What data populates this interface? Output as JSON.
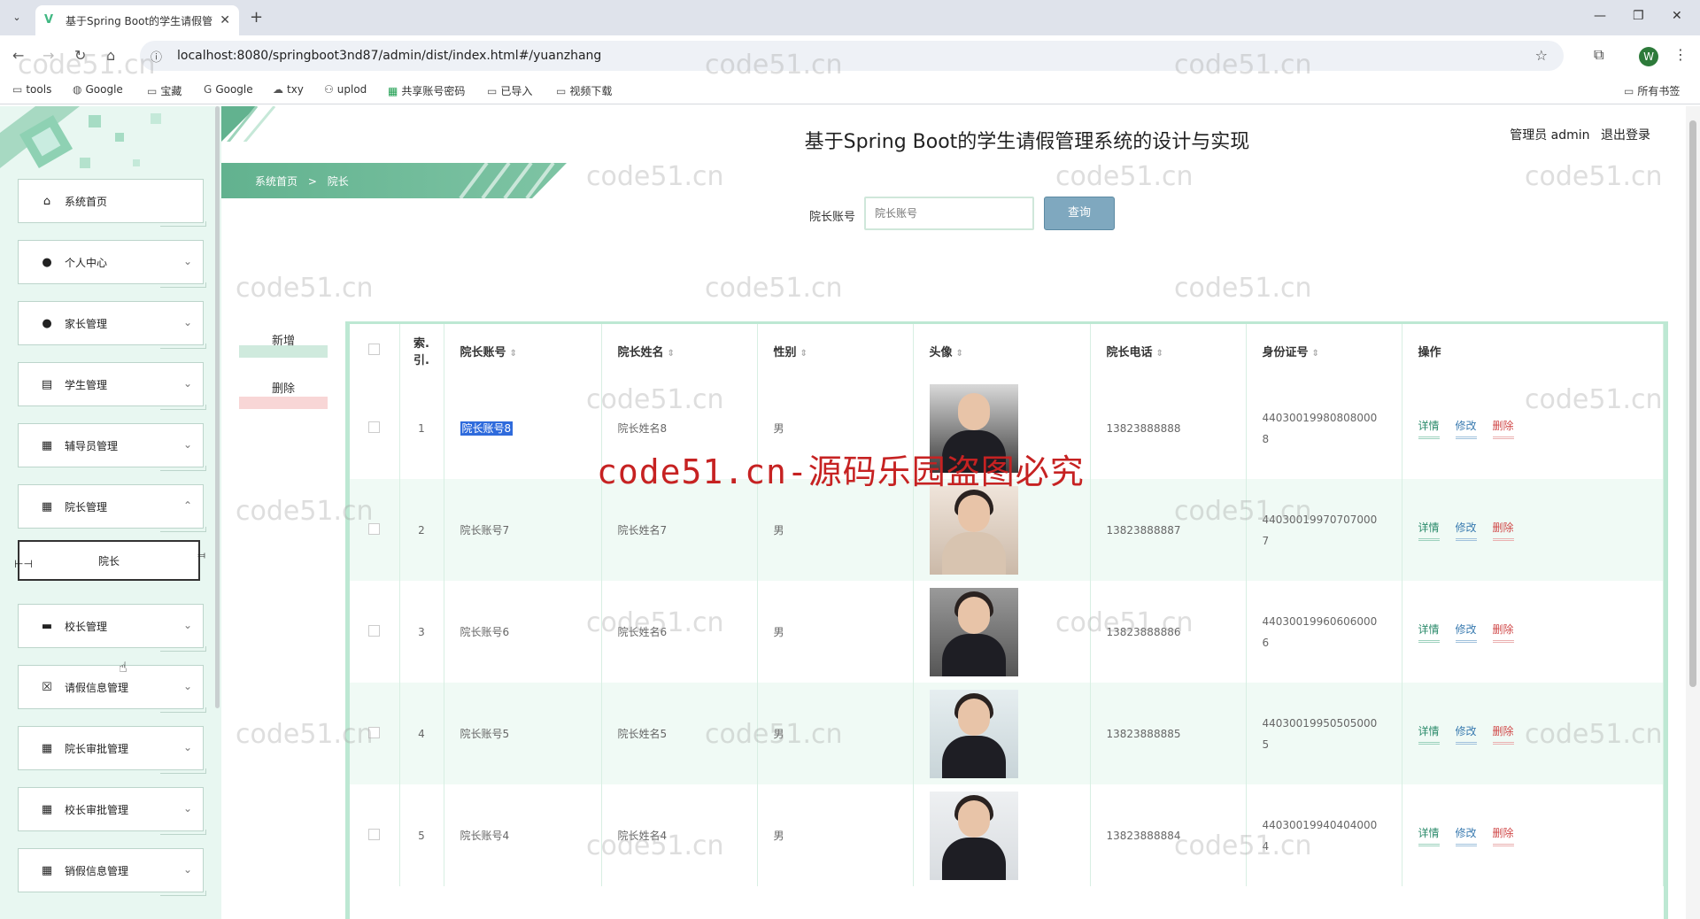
{
  "browser": {
    "tab_title": "基于Spring Boot的学生请假管",
    "url": "localhost:8080/springboot3nd87/admin/dist/index.html#/yuanzhang",
    "profile_initial": "W",
    "bookmarks": [
      {
        "label": "tools",
        "icon": "folder-icon"
      },
      {
        "label": "Google",
        "icon": "globe-icon"
      },
      {
        "label": "宝藏",
        "icon": "folder-icon"
      },
      {
        "label": "Google",
        "icon": "google-icon"
      },
      {
        "label": "txy",
        "icon": "cloud-icon"
      },
      {
        "label": "uplod",
        "icon": "people-icon"
      },
      {
        "label": "共享账号密码",
        "icon": "sheet-icon"
      },
      {
        "label": "已导入",
        "icon": "folder-icon"
      },
      {
        "label": "视频下载",
        "icon": "folder-icon"
      }
    ],
    "all_bookmarks": "所有书签"
  },
  "header": {
    "title": "基于Spring Boot的学生请假管理系统的设计与实现",
    "user_label": "管理员 admin",
    "logout": "退出登录"
  },
  "breadcrumb": {
    "home": "系统首页",
    "separator": ">",
    "current": "院长"
  },
  "sidebar": {
    "items": [
      {
        "label": "系统首页",
        "icon": "home-icon",
        "chevron": ""
      },
      {
        "label": "个人中心",
        "icon": "user-icon",
        "chevron": "⌄"
      },
      {
        "label": "家长管理",
        "icon": "user-icon",
        "chevron": "⌄"
      },
      {
        "label": "学生管理",
        "icon": "clipboard-icon",
        "chevron": "⌄"
      },
      {
        "label": "辅导员管理",
        "icon": "grid-icon",
        "chevron": "⌄"
      },
      {
        "label": "院长管理",
        "icon": "grid-icon",
        "chevron": "⌃"
      },
      {
        "label": "校长管理",
        "icon": "monitor-icon",
        "chevron": "⌄"
      },
      {
        "label": "请假信息管理",
        "icon": "calendar-x-icon",
        "chevron": "⌄"
      },
      {
        "label": "院长审批管理",
        "icon": "grid-icon",
        "chevron": "⌄"
      },
      {
        "label": "校长审批管理",
        "icon": "grid-icon",
        "chevron": "⌄"
      },
      {
        "label": "销假信息管理",
        "icon": "grid-icon",
        "chevron": "⌄"
      }
    ],
    "submenu_label": "院长"
  },
  "search": {
    "label": "院长账号",
    "placeholder": "院长账号",
    "button": "查询"
  },
  "actions": {
    "add": "新增",
    "delete": "删除"
  },
  "table": {
    "columns": [
      "索引",
      "院长账号",
      "院长姓名",
      "性别",
      "头像",
      "院长电话",
      "身份证号",
      "操作"
    ],
    "index_header": "索.\n引.",
    "ops": {
      "detail": "详情",
      "edit": "修改",
      "delete": "删除"
    },
    "rows": [
      {
        "idx": "1",
        "account": "院长账号8",
        "name": "院长姓名8",
        "gender": "男",
        "phone": "13823888888",
        "idcard_a": "44030019980808000",
        "idcard_b": "8"
      },
      {
        "idx": "2",
        "account": "院长账号7",
        "name": "院长姓名7",
        "gender": "男",
        "phone": "13823888887",
        "idcard_a": "44030019970707000",
        "idcard_b": "7"
      },
      {
        "idx": "3",
        "account": "院长账号6",
        "name": "院长姓名6",
        "gender": "男",
        "phone": "13823888886",
        "idcard_a": "44030019960606000",
        "idcard_b": "6"
      },
      {
        "idx": "4",
        "account": "院长账号5",
        "name": "院长姓名5",
        "gender": "男",
        "phone": "13823888885",
        "idcard_a": "44030019950505000",
        "idcard_b": "5"
      },
      {
        "idx": "5",
        "account": "院长账号4",
        "name": "院长姓名4",
        "gender": "男",
        "phone": "13823888884",
        "idcard_a": "44030019940404000",
        "idcard_b": "4"
      }
    ]
  },
  "watermark": {
    "red": "code51.cn-源码乐园盗图必究",
    "gray": "code51.cn"
  }
}
